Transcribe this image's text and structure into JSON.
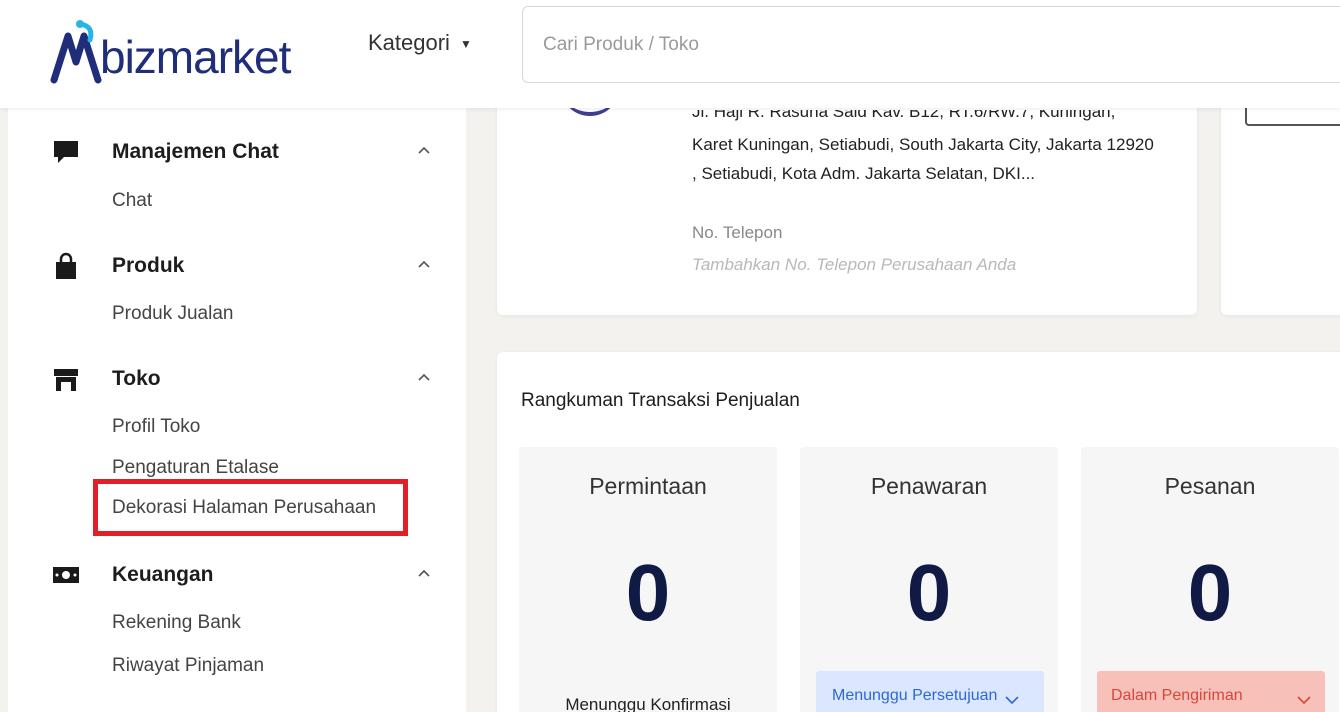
{
  "header": {
    "logo_text": "bizmarket",
    "kategori_label": "Kategori",
    "search_placeholder": "Cari Produk / Toko"
  },
  "sidebar": {
    "sections": [
      {
        "title": "Manajemen Chat",
        "icon": "chat-icon",
        "items": [
          "Chat"
        ]
      },
      {
        "title": "Produk",
        "icon": "shopping-bag-icon",
        "items": [
          "Produk Jualan"
        ]
      },
      {
        "title": "Toko",
        "icon": "store-icon",
        "items": [
          "Profil Toko",
          "Pengaturan Etalase",
          "Dekorasi Halaman Perusahaan"
        ]
      },
      {
        "title": "Keuangan",
        "icon": "money-icon",
        "items": [
          "Rekening Bank",
          "Riwayat Pinjaman"
        ]
      }
    ]
  },
  "company": {
    "address_partial": "Jl. Haji R. Rasuna Said Kav. B12, RT.6/RW.7, Kuningan,",
    "address": "Karet Kuningan, Setiabudi, South Jakarta City, Jakarta 12920 , Setiabudi, Kota Adm. Jakarta Selatan, DKI...",
    "phone_label": "No. Telepon",
    "phone_placeholder": "Tambahkan No. Telepon Perusahaan Anda"
  },
  "summary": {
    "title": "Rangkuman Transaksi Penjualan",
    "stats": [
      {
        "label": "Permintaan",
        "value": "0",
        "footer": "Menunggu Konfirmasi"
      },
      {
        "label": "Penawaran",
        "value": "0",
        "footer": "Menunggu Persetujuan"
      },
      {
        "label": "Pesanan",
        "value": "0",
        "footer": "Dalam Pengiriman"
      }
    ]
  },
  "colors": {
    "brand_navy": "#1f2d7a",
    "brand_cyan": "#27b5e8",
    "highlight_red": "#e21e26",
    "pill_blue_bg": "#dbe7ff",
    "pill_red_bg": "#f7c1b9"
  }
}
